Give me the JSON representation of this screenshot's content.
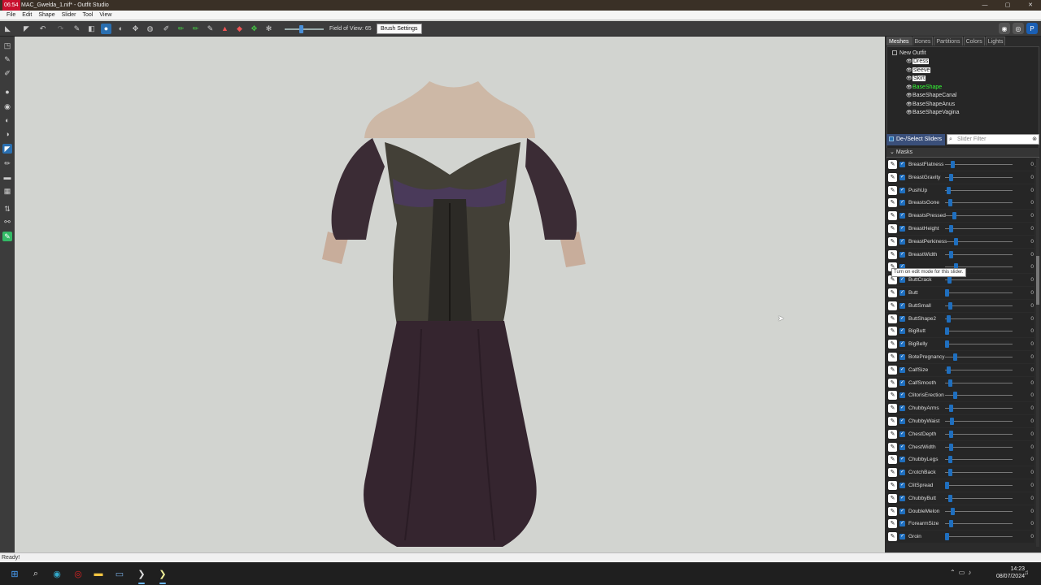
{
  "window": {
    "clock": "06:54",
    "title": "MAC_Gwelda_1.nif* - Outfit Studio",
    "min": "—",
    "max": "▢",
    "close": "✕"
  },
  "menu": [
    "File",
    "Edit",
    "Shape",
    "Slider",
    "Tool",
    "View"
  ],
  "toolbar": {
    "fov_label": "Field of View: 65",
    "brush_settings": "Brush Settings"
  },
  "tabs": [
    "Meshes",
    "Bones",
    "Partitions",
    "Colors",
    "Lights"
  ],
  "tree": {
    "root": "New Outfit",
    "nodes": [
      {
        "label": "Dress",
        "state": "selected"
      },
      {
        "label": "sleeve",
        "state": "selected"
      },
      {
        "label": "Skirt",
        "state": "selected"
      },
      {
        "label": "BaseShape",
        "state": "active"
      },
      {
        "label": "BaseShapeCanal",
        "state": "normal"
      },
      {
        "label": "BaseShapeAnus",
        "state": "normal"
      },
      {
        "label": "BaseShapeVagina",
        "state": "normal"
      }
    ]
  },
  "sliders_panel": {
    "deselect_label": "De-/Select Sliders",
    "filter_placeholder": "Slider Filter",
    "masks_label": "Masks",
    "tooltip": "Turn on edit mode for this slider.",
    "items": [
      {
        "name": "BreastFlatness",
        "level": 0.08,
        "value": "0"
      },
      {
        "name": "BreastGravity",
        "level": 0.06,
        "value": "0"
      },
      {
        "name": "PushUp",
        "level": 0.02,
        "value": "0"
      },
      {
        "name": "BreastsGone",
        "level": 0.05,
        "value": "0"
      },
      {
        "name": "BreastsPressed",
        "level": 0.11,
        "value": "0"
      },
      {
        "name": "BreastHeight",
        "level": 0.06,
        "value": "0"
      },
      {
        "name": "BreastPerkiness",
        "level": 0.13,
        "value": "0"
      },
      {
        "name": "BreastWidth",
        "level": 0.06,
        "value": "0"
      },
      {
        "name": "",
        "level": 0.13,
        "value": "0"
      },
      {
        "name": "ButtCrack",
        "level": 0.04,
        "value": "0"
      },
      {
        "name": "Butt",
        "level": 0.0,
        "value": "0"
      },
      {
        "name": "ButtSmall",
        "level": 0.05,
        "value": "0"
      },
      {
        "name": "ButtShape2",
        "level": 0.03,
        "value": "0"
      },
      {
        "name": "BigButt",
        "level": 0.0,
        "value": "0"
      },
      {
        "name": "BigBelly",
        "level": 0.0,
        "value": "0"
      },
      {
        "name": "BotePregnancy",
        "level": 0.12,
        "value": "0"
      },
      {
        "name": "CalfSize",
        "level": 0.02,
        "value": "0"
      },
      {
        "name": "CalfSmooth",
        "level": 0.05,
        "value": "0"
      },
      {
        "name": "ClitorisErection",
        "level": 0.12,
        "value": "0"
      },
      {
        "name": "ChubbyArms",
        "level": 0.06,
        "value": "0"
      },
      {
        "name": "ChubbyWaist",
        "level": 0.07,
        "value": "0"
      },
      {
        "name": "ChestDepth",
        "level": 0.06,
        "value": "0"
      },
      {
        "name": "ChestWidth",
        "level": 0.06,
        "value": "0"
      },
      {
        "name": "ChubbyLegs",
        "level": 0.05,
        "value": "0"
      },
      {
        "name": "CrotchBack",
        "level": 0.05,
        "value": "0"
      },
      {
        "name": "ClitSpread",
        "level": 0.0,
        "value": "0"
      },
      {
        "name": "ChubbyButt",
        "level": 0.05,
        "value": "0"
      },
      {
        "name": "DoubleMelon",
        "level": 0.09,
        "value": "0"
      },
      {
        "name": "ForearmSize",
        "level": 0.06,
        "value": "0"
      },
      {
        "name": "Groin",
        "level": 0.0,
        "value": "0"
      }
    ]
  },
  "status": "Ready!",
  "tray": {
    "time": "14:23",
    "date": "08/07/2024"
  },
  "colors": {
    "accent": "#2a6fb0",
    "green_label": "#35ff35",
    "dress_dark": "#3a2a33"
  }
}
